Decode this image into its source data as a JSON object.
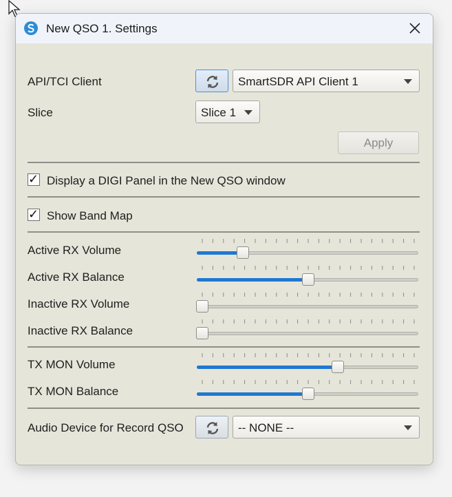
{
  "window": {
    "title": "New QSO 1. Settings"
  },
  "api_client": {
    "label": "API/TCI Client",
    "selected": "SmartSDR API Client 1"
  },
  "slice": {
    "label": "Slice",
    "selected": "Slice 1"
  },
  "apply_button": {
    "label": "Apply"
  },
  "digi_panel": {
    "label": "Display a DIGI Panel in the New QSO window",
    "checked": true
  },
  "band_map": {
    "label": "Show Band Map",
    "checked": true
  },
  "sliders": [
    {
      "label": "Active RX Volume",
      "value": 0.19
    },
    {
      "label": "Active RX Balance",
      "value": 0.5
    },
    {
      "label": "Inactive RX Volume",
      "value": 0.0
    },
    {
      "label": "Inactive RX Balance",
      "value": 0.0
    },
    {
      "label": "TX MON Volume",
      "value": 0.64
    },
    {
      "label": "TX MON Balance",
      "value": 0.5
    }
  ],
  "audio_device": {
    "label": "Audio Device for Record QSO",
    "selected": "-- NONE --"
  },
  "colors": {
    "accent": "#1f78d1",
    "window_bg": "#e6e5da",
    "titlebar_bg": "#f0f4fa"
  },
  "icons": {
    "app": "app-logo-icon",
    "close": "close-icon",
    "refresh": "refresh-icon",
    "dropdown": "chevron-down-icon"
  }
}
